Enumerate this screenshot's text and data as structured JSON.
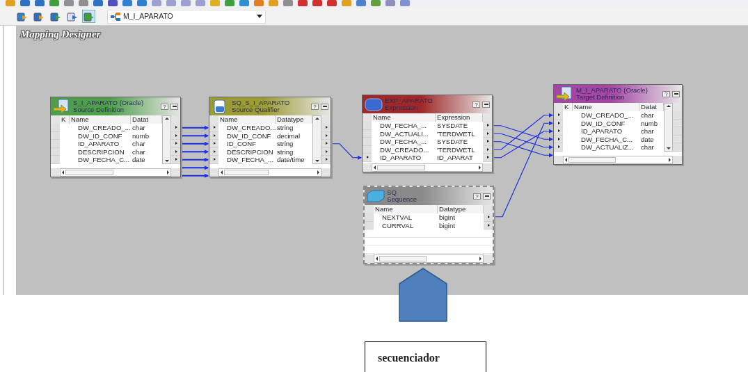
{
  "toolbar": {
    "mapping": "M_I_APARATO"
  },
  "canvas": {
    "title": "Mapping Designer"
  },
  "transformations": [
    {
      "kind": "source",
      "title": "S_I_APARATO (Oracle)",
      "subtitle": "Source Definition",
      "color": "#4e9e4a",
      "selected": false,
      "help": "?",
      "columns": [
        "K",
        "Name",
        "Datat"
      ],
      "rows": [
        {
          "name": "DW_CREADO_...",
          "value": "char",
          "in": false,
          "out": true
        },
        {
          "name": "DW_ID_CONF",
          "value": "numb",
          "in": false,
          "out": true
        },
        {
          "name": "ID_APARATO",
          "value": "char",
          "in": false,
          "out": true
        },
        {
          "name": "DESCRIPCION",
          "value": "char",
          "in": false,
          "out": true
        },
        {
          "name": "DW_FECHA_C...",
          "value": "date",
          "in": false,
          "out": true
        }
      ]
    },
    {
      "kind": "qualifier",
      "title": "SQ_S_I_APARATO",
      "subtitle": "Source Qualifier",
      "color": "#9c9c34",
      "selected": false,
      "help": "?",
      "columns": [
        "Name",
        "Datatype"
      ],
      "rows": [
        {
          "name": "DW_CREADO...",
          "value": "string",
          "in": true,
          "out": true
        },
        {
          "name": "DW_ID_CONF",
          "value": "decimal",
          "in": true,
          "out": true
        },
        {
          "name": "ID_CONF",
          "value": "string",
          "in": true,
          "out": true
        },
        {
          "name": "DESCRIPCION",
          "value": "string",
          "in": true,
          "out": true
        },
        {
          "name": "DW_FECHA_...",
          "value": "date/time",
          "in": true,
          "out": true
        }
      ]
    },
    {
      "kind": "expression",
      "title": "EXP_APARATO",
      "subtitle": "Expression",
      "color": "#a02828",
      "selected": false,
      "help": "?",
      "columns": [
        "Name",
        "Expression"
      ],
      "rows": [
        {
          "name": "DW_FECHA_...",
          "value": "SYSDATE",
          "in": false,
          "out": true
        },
        {
          "name": "DW_ACTUALI...",
          "value": "'TERDWETL",
          "in": false,
          "out": true
        },
        {
          "name": "DW_FECHA_...",
          "value": "SYSDATE",
          "in": false,
          "out": true
        },
        {
          "name": "DW_CREADO...",
          "value": "'TERDWETL",
          "in": false,
          "out": true
        },
        {
          "name": "ID_APARATO",
          "value": "ID_APARAT",
          "in": true,
          "out": true
        }
      ]
    },
    {
      "kind": "target",
      "title": "M_I_APARATO (Oracle)",
      "subtitle": "Target Definition",
      "color": "#a447a4",
      "selected": false,
      "help": "?",
      "columns": [
        "K",
        "Name",
        "Datat"
      ],
      "rows": [
        {
          "name": "DW_CREADO_...",
          "value": "char",
          "in": true,
          "out": false
        },
        {
          "name": "DW_ID_CONF",
          "value": "numb",
          "in": true,
          "out": false
        },
        {
          "name": "ID_APARATO",
          "value": "char",
          "in": true,
          "out": false
        },
        {
          "name": "DW_FECHA_C...",
          "value": "date",
          "in": true,
          "out": false
        },
        {
          "name": "DW_ACTUALIZ...",
          "value": "char",
          "in": true,
          "out": false
        }
      ]
    },
    {
      "kind": "sequence",
      "title": "SQ",
      "subtitle": "Sequence",
      "color": "#8a8a8a",
      "selected": true,
      "help": "?",
      "columns": [
        "Name",
        "Datatype"
      ],
      "rows": [
        {
          "name": "NEXTVAL",
          "value": "bigint",
          "in": false,
          "out": true
        },
        {
          "name": "CURRVAL",
          "value": "bigint",
          "in": false,
          "out": true
        }
      ]
    }
  ],
  "callout": {
    "label": "secuenciador"
  }
}
